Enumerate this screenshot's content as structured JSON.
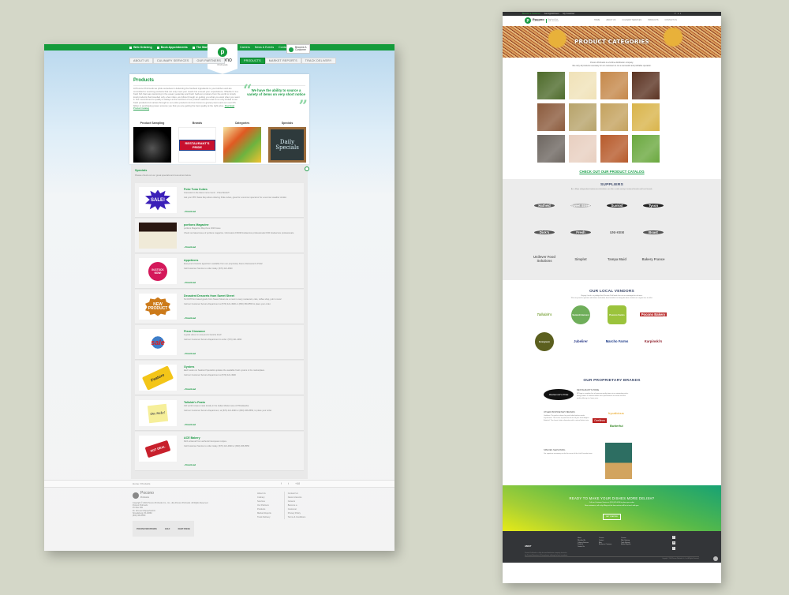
{
  "old_site": {
    "topbar": {
      "left_links": [
        "Web Ordering",
        "Book Appointments",
        "The Market"
      ],
      "right_links": [
        "Careers",
        "News & Events",
        "Contact Us"
      ],
      "become_customer": "Become A Customer"
    },
    "logo": {
      "name": "Pocono",
      "sub": "ProFoods"
    },
    "nav_left": [
      "About Us",
      "Culinary Services",
      "Our Partners"
    ],
    "nav_right": [
      "Products",
      "Market Reports",
      "Track Delivery"
    ],
    "active_nav": "Products",
    "products": {
      "title": "Products",
      "intro": "At Pocono ProFoods we pride ourselves in delivering the freshest ingredients to your kitchen and are committed to sourcing products that not only meet your needs but exceed your expectations. Whether it is a fresh fish that was swimming in the ocean yesterday and fresh heirloom produce from the world or simply local products that travelled only a few miles, we follow through on getting you what you want when you want it. Our commitment to quality is always at the forefront of our product selection and is not only limited to our fresh products but carries through to our entire product mix from frozen to grocery items and our over 8.5 billion in purchasing power ensures you that you are getting the best quality at the right price.",
      "intro_link": "Download Product Catalog",
      "quote": "We have the ability to source a variety of items on very short notice",
      "tiles": [
        {
          "label": "Product Sampling"
        },
        {
          "label": "Brands",
          "image_text": "RESTAURANT'S PRIDE"
        },
        {
          "label": "Categories"
        },
        {
          "label": "Specials",
          "image_text": [
            "Daily",
            "Specials"
          ]
        }
      ]
    },
    "specials": {
      "title": "Specials",
      "description": "Please check out our great specials and resources below.",
      "download_label": "Download",
      "items": [
        {
          "title": "Poke Tuna Cubes",
          "line1": "Interested in the latest menu trend... Poke Bowls?!",
          "line2": "Ask your PPF Sales Rep about ordering Poke cubes, great for a summer special or for a summer weather stroller.",
          "badge": "SALE!"
        },
        {
          "title": "portions Magazine",
          "line1": "portions Magazine May/June 2016 Issue",
          "line2": "Check out latest issue of portions magazine. Information FROM foodservice professionals FOR foodservice professionals.",
          "badge": ""
        },
        {
          "title": "Appetizers",
          "line1": "Everyone's favorite appetizers available from our proprietary brand, Restaurant's Pride!",
          "line2": "Call Customer Service to order today. (570) 421-4990",
          "badge": "IN-STOCK NOW!"
        },
        {
          "title": "Decadent Desserts from Sweet Street",
          "line1": "5-FOOTPrint baked goods from Sweet Street are a must in every restaurant, cafe, coffee shop, pub & more!",
          "line2": "Call our Customer Service Department at (570) 421-4990 or (800) 366-8550 to place your order.",
          "badge": "NEW PRODUCT"
        },
        {
          "title": "Pizza Clearance",
          "line1": "A great value on everyone's favorite food!",
          "line2": "Call our Customer Service Department to order. (570) 421-4990",
          "badge": "sale"
        },
        {
          "title": "Oysters",
          "line1": "Each week our Seafood Specialist updates the available fresh oysters in the marketplace.",
          "line2": "Call our Customer Service Department at (570) 421-4990",
          "badge": "Feature"
        },
        {
          "title": "Tallulah's Pasta",
          "line1": "Old world recipes made locally in the Italian Market area of Philadelphia.",
          "line2": "Call our Customer Service Department, at (570) 421-4990 or (800) 366-8550, to place your order.",
          "badge": "On Sale!"
        },
        {
          "title": "ACE Bakery",
          "line1": "Rich artisanal from authentic European recipes.",
          "line2": "Call Customer Service to order today. (570) 421-4990 or (800) 366-8550",
          "badge": "HOT DEAL"
        }
      ]
    },
    "breadcrumb": [
      "Home",
      "Products"
    ],
    "social": [
      "f",
      "t",
      "+68"
    ],
    "footer": {
      "logo": "Pocono",
      "logo_sub": "ProFoods",
      "address": [
        "Copyright © 2016 Pocono ProFoods Co., Inc., dba Pocono ProFoods. All Rights Reserved.",
        "Pocono ProFoods",
        "PO Box 669",
        "Rt. 191 and Chipperfield Dr.",
        "Stroudsburg, PA 18360",
        "(800) 366-8550"
      ],
      "col1": [
        "About Us",
        "Culinary Services",
        "Our Partners",
        "Products",
        "Market Reports",
        "Track Delivery"
      ],
      "col2": [
        "Contact Us",
        "News & Events",
        "Careers",
        "Become a Customer",
        "Privacy Policy",
        "Terms & Conditions"
      ],
      "associations": [
        "POCONO MOUNTAINS",
        "GOLF",
        "KEEP FRESH"
      ]
    }
  },
  "new_site": {
    "topbar": {
      "links": [
        "Become a Customer",
        "Get Appointment",
        "My Customer"
      ],
      "social": "f t i"
    },
    "logo": {
      "name": "Pocono",
      "sub": "ProFoods",
      "tagline": "Buy local, Eat well, Go farther"
    },
    "nav": [
      "Home",
      "About Us",
      "Culinary Services",
      "Products",
      "Contact Us"
    ],
    "hero_title": "PRODUCT CATEGORIES",
    "intro": [
      "Pocono ProFoods is a full line distribution company.",
      "We carry all products necessary for our customers to run a successful and profitable operation."
    ],
    "category_colors": [
      "#4d6a2a",
      "#f0e2b8",
      "#c5884a",
      "#5b3322",
      "#8b5a3c",
      "#b7a36a",
      "#c4a25e",
      "#d9b44a",
      "#6d6660",
      "#e8cfc0",
      "#b75a2b",
      "#6aa83e"
    ],
    "catalog_link": "CHECK OUT OUR PRODUCT CATALOG",
    "suppliers": {
      "title": "SUPPLIERS",
      "description": "As a Major independent foodservice distributor, we offer a wide variety of national brands and local brands.",
      "logos": [
        "Hatfield",
        "Sweet Street",
        "Sunkist",
        "Tyson",
        "Dick's",
        "Fresh",
        "UNI-KEM",
        "Boast",
        "Unilever Food Solutions",
        "Simplot",
        "Tampa Maid",
        "Bakery France"
      ]
    },
    "vendors": {
      "title": "OUR LOCAL VENDORS",
      "description": [
        "Buying Local is a pledge that Pocono ProFoods has on our managed to achieve.",
        "We are proud to partner with these and other local vendors to bring the best of what our region has to offer."
      ],
      "logos": [
        "Tallulah's",
        "Summit Harvest",
        "Pocono Farms",
        "Pocono Bakery",
        "Evergreen",
        "Jubelirer",
        "Marcho Farms",
        "Karpinski's"
      ]
    },
    "brands": {
      "title": "OUR PROPRIETARY BRANDS",
      "restaurants_pride_title": "RESTAURANT'S PRIDE",
      "restaurants_pride_text": "RP logo is complete line of premium quality items at an outstanding value. Every product is selected under strict specifications to ensure the best quality offering at a lower price.",
      "other_title": "OTHER PROPRIETARY BRANDS",
      "other_lines": [
        "Ovellinos: The perfect choice for your Italian kitchen needs.",
        "Frycalicious: The choice of premium oils for all your fried delights.",
        "Butterful: The classic butter alternative with a natural butter taste."
      ],
      "other_logos": [
        "frycalicious",
        "Ovellinos",
        "Butterful"
      ],
      "specialties_title": "SPECIES SEASONING",
      "specialties_text": "Our signature seasoning can be the secret of the chef's favorite items."
    },
    "ready": {
      "title": "READY TO MAKE YOUR DISHES MORE DELISH?",
      "line1": "Call our Customer Service at (570) 421-4990 to place your order.",
      "line2": "New customers, call us by filling out the form and we will be in touch with you.",
      "button": "GET STARTED"
    },
    "footer": {
      "about_title": "ABOUT",
      "about_text": "Pocono ProFoods is a fully licensed distribution company located in the Pocono Mountains of Pennsylvania, offering the best in products and services.",
      "col1": [
        "Home",
        "Who Are We",
        "Culinary Services",
        "Products",
        "Contact Us"
      ],
      "col2": [
        "Careers",
        "Contact",
        "Blog",
        "Become a Customer"
      ],
      "col3": [
        "Careers",
        "Web Ordering",
        "Track Delivery",
        "Market Reports"
      ],
      "copyright": "Copyright © 2016 Pocono ProFoods Co., Inc. All Rights Reserved."
    }
  }
}
